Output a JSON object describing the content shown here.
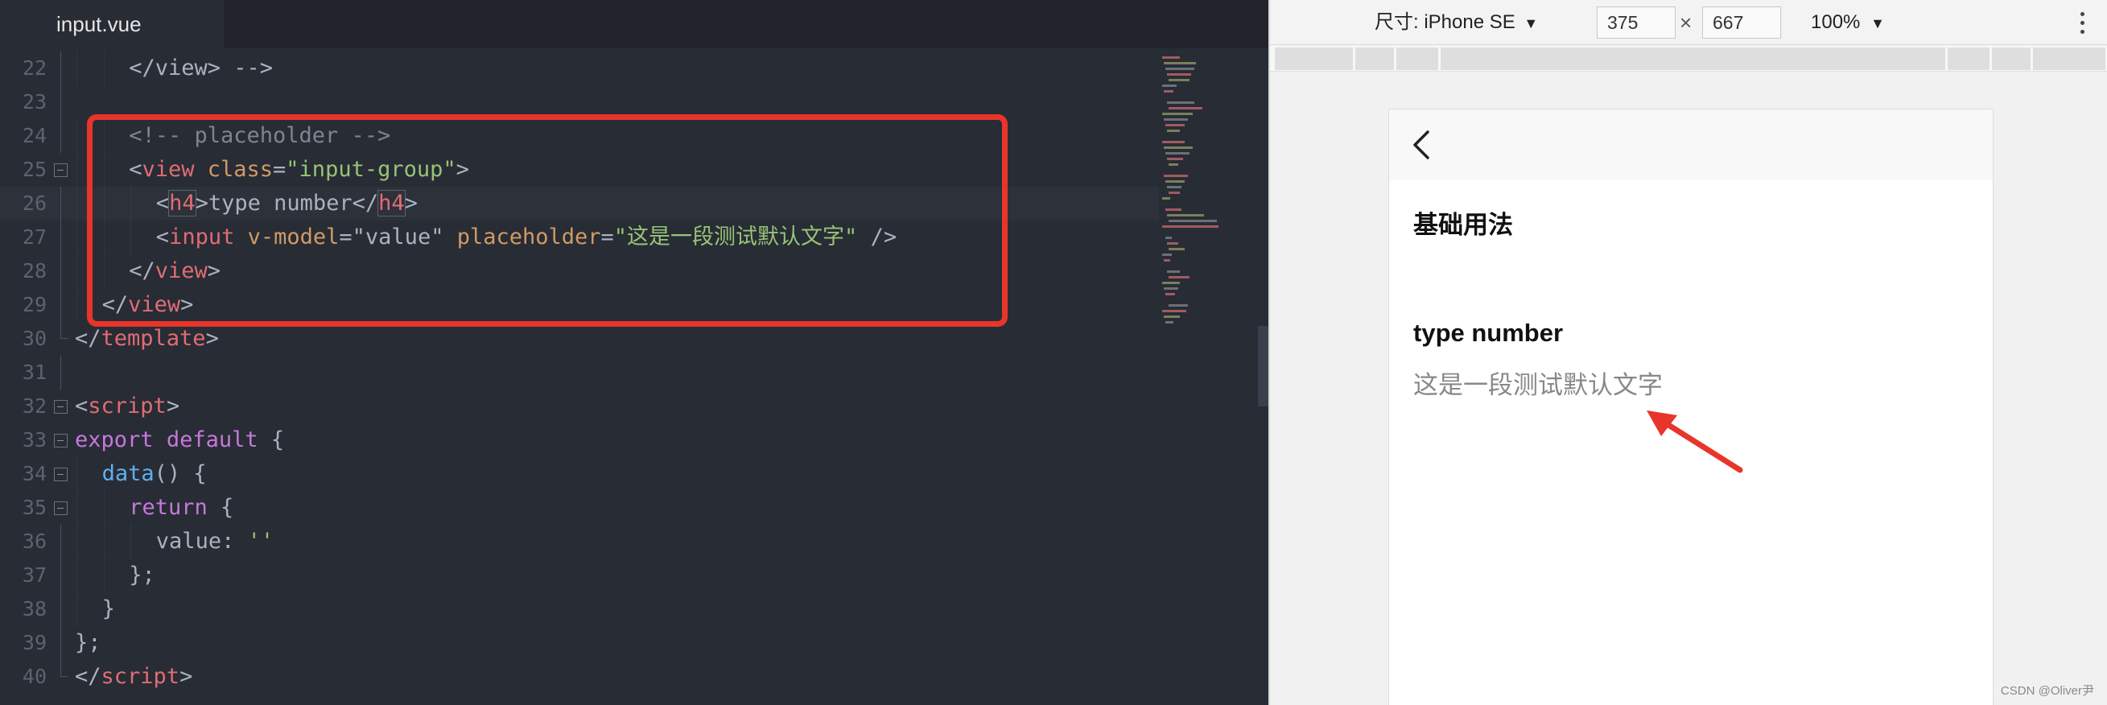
{
  "editor": {
    "tab_label": "input.vue",
    "lines": [
      {
        "no": "22",
        "indent": 2,
        "tokens": [
          [
            "p",
            "</view> -->"
          ]
        ]
      },
      {
        "no": "23",
        "indent": 0,
        "tokens": []
      },
      {
        "no": "24",
        "indent": 2,
        "tokens": [
          [
            "c",
            "<!-- placeholder -->"
          ]
        ]
      },
      {
        "no": "25",
        "indent": 2,
        "fold": true,
        "tokens": [
          [
            "p",
            "<"
          ],
          [
            "tag",
            "view"
          ],
          [
            "p",
            " "
          ],
          [
            "attr",
            "class"
          ],
          [
            "p",
            "="
          ],
          [
            "str",
            "\"input-group\""
          ],
          [
            "p",
            ">"
          ]
        ]
      },
      {
        "no": "26",
        "indent": 3,
        "current": true,
        "tokens": [
          [
            "p",
            "<"
          ],
          [
            "tagh",
            "h4"
          ],
          [
            "p",
            ">type number</"
          ],
          [
            "tagh",
            "h4"
          ],
          [
            "p",
            ">"
          ]
        ]
      },
      {
        "no": "27",
        "indent": 3,
        "tokens": [
          [
            "p",
            "<"
          ],
          [
            "tag",
            "input"
          ],
          [
            "p",
            " "
          ],
          [
            "attr",
            "v-model"
          ],
          [
            "p",
            "=\"value\" "
          ],
          [
            "attr",
            "placeholder"
          ],
          [
            "p",
            "="
          ],
          [
            "str",
            "\"这是一段测试默认文字\""
          ],
          [
            "p",
            " />"
          ]
        ]
      },
      {
        "no": "28",
        "indent": 2,
        "tokens": [
          [
            "p",
            "</"
          ],
          [
            "tag",
            "view"
          ],
          [
            "p",
            ">"
          ]
        ]
      },
      {
        "no": "29",
        "indent": 1,
        "tokens": [
          [
            "p",
            "</"
          ],
          [
            "tag",
            "view"
          ],
          [
            "p",
            ">"
          ]
        ]
      },
      {
        "no": "30",
        "indent": 0,
        "end": true,
        "tokens": [
          [
            "p",
            "</"
          ],
          [
            "tag",
            "template"
          ],
          [
            "p",
            ">"
          ]
        ]
      },
      {
        "no": "31",
        "indent": 0,
        "tokens": []
      },
      {
        "no": "32",
        "indent": 0,
        "fold": true,
        "tokens": [
          [
            "p",
            "<"
          ],
          [
            "tag",
            "script"
          ],
          [
            "p",
            ">"
          ]
        ]
      },
      {
        "no": "33",
        "indent": 0,
        "fold": true,
        "tokens": [
          [
            "kw",
            "export"
          ],
          [
            "p",
            " "
          ],
          [
            "kw",
            "default"
          ],
          [
            "p",
            " {"
          ]
        ]
      },
      {
        "no": "34",
        "indent": 1,
        "fold": true,
        "tokens": [
          [
            "fn",
            "data"
          ],
          [
            "p",
            "() {"
          ]
        ]
      },
      {
        "no": "35",
        "indent": 2,
        "fold": true,
        "tokens": [
          [
            "kw",
            "return"
          ],
          [
            "p",
            " {"
          ]
        ]
      },
      {
        "no": "36",
        "indent": 3,
        "tokens": [
          [
            "p",
            "value: "
          ],
          [
            "str",
            "''"
          ]
        ]
      },
      {
        "no": "37",
        "indent": 2,
        "tokens": [
          [
            "p",
            "};"
          ]
        ]
      },
      {
        "no": "38",
        "indent": 1,
        "tokens": [
          [
            "p",
            "}"
          ]
        ]
      },
      {
        "no": "39",
        "indent": 0,
        "tokens": [
          [
            "p",
            "};"
          ]
        ]
      },
      {
        "no": "40",
        "indent": 0,
        "end": true,
        "tokens": [
          [
            "p",
            "</"
          ],
          [
            "tag",
            "script"
          ],
          [
            "p",
            ">"
          ]
        ]
      }
    ]
  },
  "simulator": {
    "device_label": "尺寸: iPhone SE",
    "device_caret": "▼",
    "width_value": "375",
    "times": "×",
    "height_value": "667",
    "zoom_label": "100%",
    "zoom_caret": "▼",
    "page": {
      "section_title": "基础用法",
      "h4": "type number",
      "input_placeholder": "这是一段测试默认文字"
    }
  },
  "watermark": "CSDN @Oliver尹",
  "colors": {
    "editor_bg": "#282c34",
    "highlight_box": "#e8352b",
    "arrow": "#e8352b"
  }
}
